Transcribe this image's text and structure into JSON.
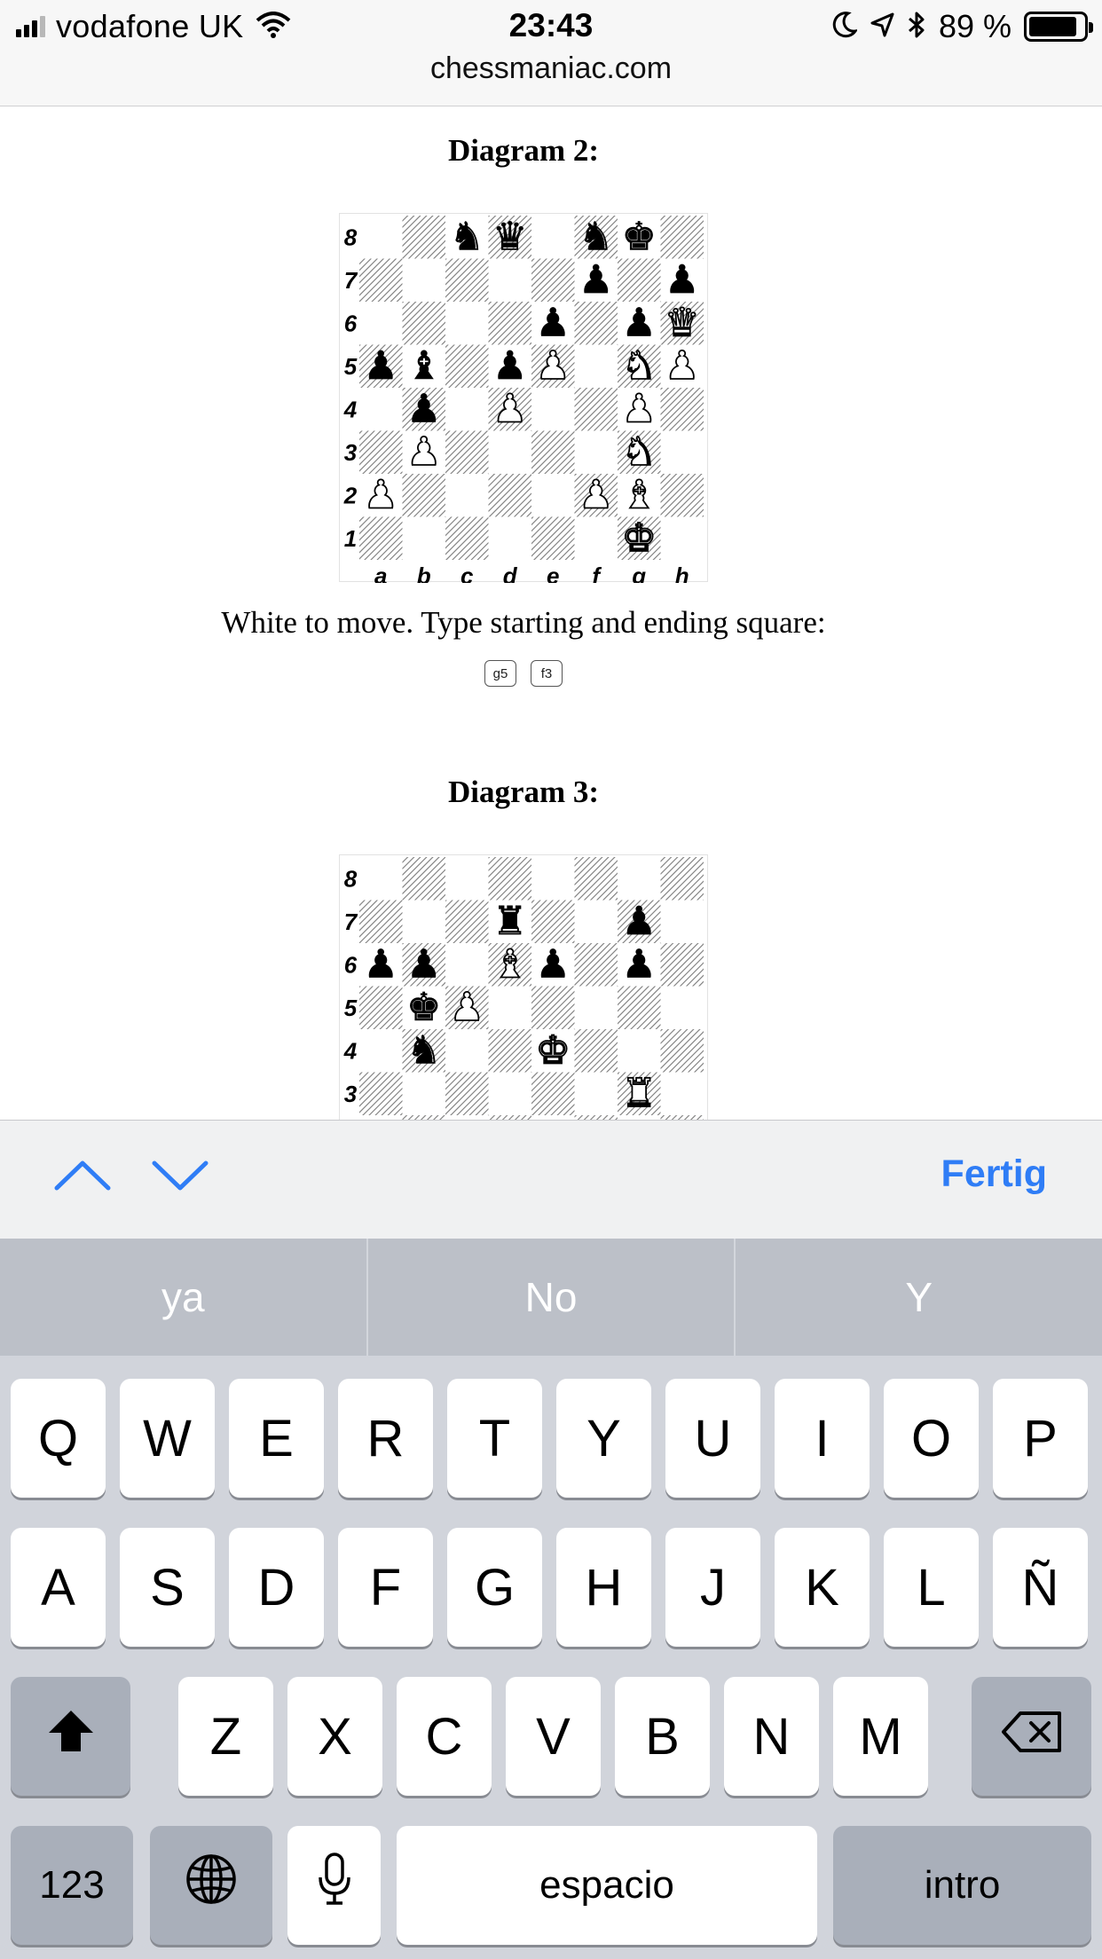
{
  "status_bar": {
    "carrier": "vodafone UK",
    "time": "23:43",
    "battery_percent": "89 %",
    "battery_level": 0.89,
    "url": "chessmaniac.com",
    "icons": [
      "signal-icon",
      "wifi-icon",
      "moon-icon",
      "location-arrow-icon",
      "bluetooth-icon",
      "battery-icon"
    ]
  },
  "page": {
    "diagram2": {
      "title": "Diagram 2:",
      "pieces": [
        {
          "square": "c8",
          "piece": "bN"
        },
        {
          "square": "d8",
          "piece": "bQ"
        },
        {
          "square": "f8",
          "piece": "bN"
        },
        {
          "square": "g8",
          "piece": "bK"
        },
        {
          "square": "f7",
          "piece": "bP"
        },
        {
          "square": "h7",
          "piece": "bP"
        },
        {
          "square": "e6",
          "piece": "bP"
        },
        {
          "square": "g6",
          "piece": "bP"
        },
        {
          "square": "h6",
          "piece": "wQ"
        },
        {
          "square": "a5",
          "piece": "bP"
        },
        {
          "square": "b5",
          "piece": "bB"
        },
        {
          "square": "d5",
          "piece": "bP"
        },
        {
          "square": "e5",
          "piece": "wP"
        },
        {
          "square": "g5",
          "piece": "wN"
        },
        {
          "square": "h5",
          "piece": "wP"
        },
        {
          "square": "b4",
          "piece": "bP"
        },
        {
          "square": "d4",
          "piece": "wP"
        },
        {
          "square": "g4",
          "piece": "wP"
        },
        {
          "square": "b3",
          "piece": "wP"
        },
        {
          "square": "g3",
          "piece": "wN"
        },
        {
          "square": "a2",
          "piece": "wP"
        },
        {
          "square": "f2",
          "piece": "wP"
        },
        {
          "square": "g2",
          "piece": "wB"
        },
        {
          "square": "g1",
          "piece": "wK"
        }
      ]
    },
    "prompt": "White to move. Type starting and ending square:",
    "start_square_value": "g5",
    "end_square_value": "f3",
    "diagram3": {
      "title": "Diagram 3:",
      "pieces": [
        {
          "square": "d7",
          "piece": "bR"
        },
        {
          "square": "g7",
          "piece": "bP"
        },
        {
          "square": "a6",
          "piece": "bP"
        },
        {
          "square": "b6",
          "piece": "bP"
        },
        {
          "square": "d6",
          "piece": "wB"
        },
        {
          "square": "e6",
          "piece": "bP"
        },
        {
          "square": "g6",
          "piece": "bP"
        },
        {
          "square": "b5",
          "piece": "bK"
        },
        {
          "square": "c5",
          "piece": "wP"
        },
        {
          "square": "b4",
          "piece": "bN"
        },
        {
          "square": "e4",
          "piece": "wK"
        },
        {
          "square": "g3",
          "piece": "wR"
        }
      ]
    },
    "files": [
      "a",
      "b",
      "c",
      "d",
      "e",
      "f",
      "g",
      "h"
    ],
    "ranks": [
      "8",
      "7",
      "6",
      "5",
      "4",
      "3",
      "2",
      "1"
    ]
  },
  "accessory_bar": {
    "prev_icon": "chevron-up-icon",
    "next_icon": "chevron-down-icon",
    "done_label": "Fertig"
  },
  "keyboard": {
    "suggestions": [
      "ya",
      "No",
      "Y"
    ],
    "row1": [
      "Q",
      "W",
      "E",
      "R",
      "T",
      "Y",
      "U",
      "I",
      "O",
      "P"
    ],
    "row2": [
      "A",
      "S",
      "D",
      "F",
      "G",
      "H",
      "J",
      "K",
      "L",
      "Ñ"
    ],
    "row3": [
      "Z",
      "X",
      "C",
      "V",
      "B",
      "N",
      "M"
    ],
    "numbers_label": "123",
    "space_label": "espacio",
    "return_label": "intro",
    "icons": [
      "shift-icon",
      "backspace-icon",
      "globe-icon",
      "microphone-icon"
    ]
  }
}
